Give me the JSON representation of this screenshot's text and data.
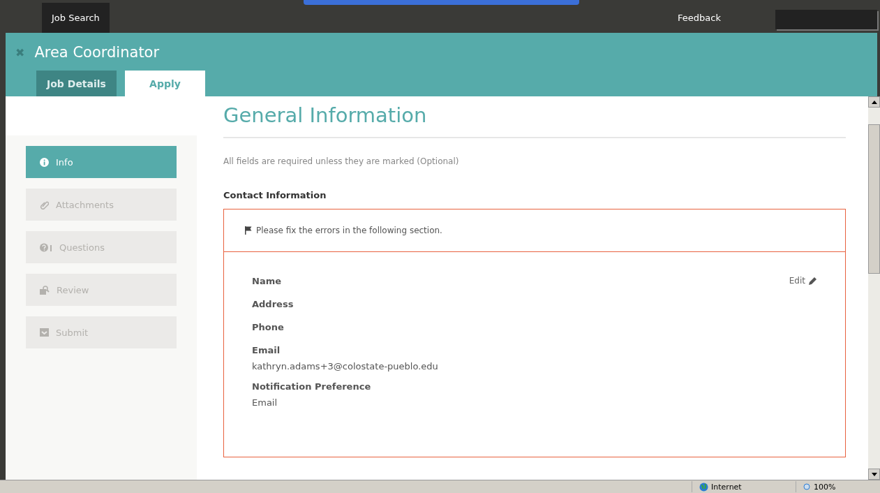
{
  "topbar": {
    "nav": [
      {
        "label": "Job Search",
        "selected": true
      },
      {
        "label": "Feedback",
        "selected": false
      }
    ]
  },
  "header": {
    "close": "✖",
    "title": "Area Coordinator",
    "tabs": [
      {
        "label": "Job Details",
        "selected": false
      },
      {
        "label": "Apply",
        "selected": true
      }
    ]
  },
  "sidebar": {
    "items": [
      {
        "label": "Info",
        "kind": "info",
        "selected": true
      },
      {
        "label": "Attachments",
        "kind": "attachments",
        "selected": false
      },
      {
        "label": "Questions",
        "kind": "questions",
        "selected": false
      },
      {
        "label": "Review",
        "kind": "review",
        "selected": false
      },
      {
        "label": "Submit",
        "kind": "submit",
        "selected": false
      }
    ]
  },
  "main": {
    "title": "General Information",
    "note": "All fields are required unless they are marked (Optional)",
    "section": "Contact Information",
    "error": "Please fix the errors in the following section.",
    "edit": "Edit",
    "fields": [
      {
        "label": "Name"
      },
      {
        "label": "Address"
      },
      {
        "label": "Phone"
      },
      {
        "label": "Email",
        "value": "kathryn.adams+3@colostate-pueblo.edu"
      },
      {
        "label": "Notification Preference",
        "value": "Email"
      }
    ]
  },
  "status_bar": {
    "zone": "Internet",
    "zoom": "100%"
  }
}
